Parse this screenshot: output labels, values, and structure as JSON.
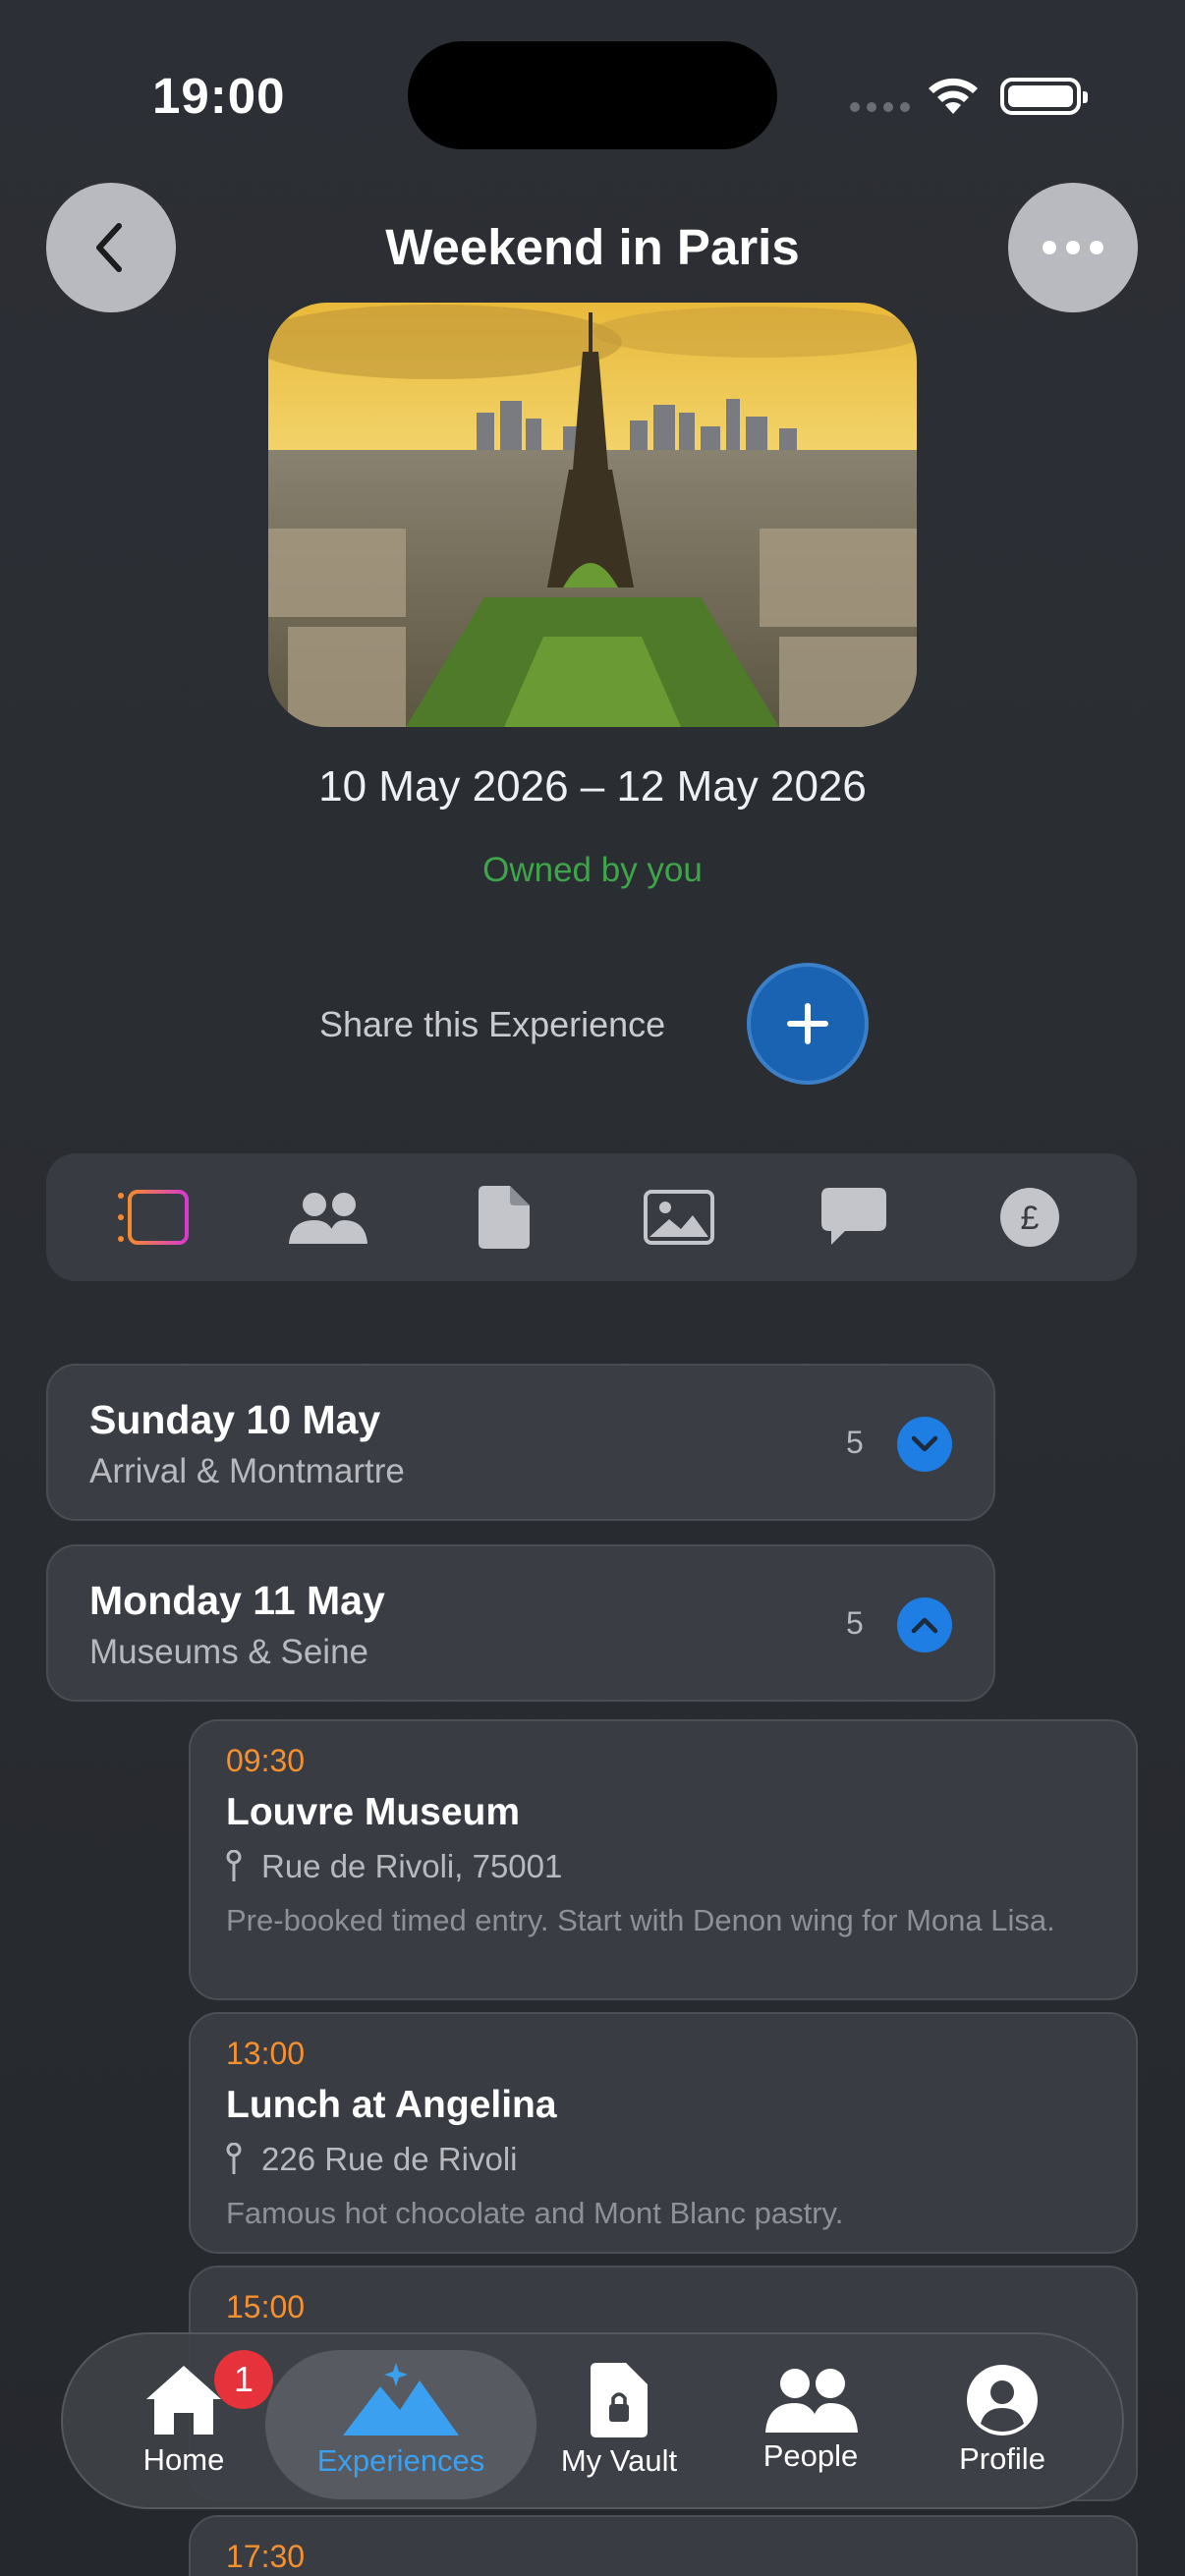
{
  "status": {
    "time": "19:00"
  },
  "header": {
    "title": "Weekend in Paris"
  },
  "trip": {
    "dates": "10 May 2026 – 12 May 2026",
    "owner": "Owned by you",
    "share_label": "Share this Experience"
  },
  "tabs": [
    "itinerary-icon",
    "people-icon",
    "document-icon",
    "photo-icon",
    "chat-icon",
    "pound-icon"
  ],
  "days": [
    {
      "title": "Sunday 10 May",
      "subtitle": "Arrival & Montmartre",
      "count": "5",
      "expanded": false
    },
    {
      "title": "Monday 11 May",
      "subtitle": "Museums & Seine",
      "count": "5",
      "expanded": true
    }
  ],
  "events": [
    {
      "time": "09:30",
      "title": "Louvre Museum",
      "location": "Rue de Rivoli, 75001",
      "note": "Pre-booked timed entry. Start with Denon wing for Mona Lisa."
    },
    {
      "time": "13:00",
      "title": "Lunch at Angelina",
      "location": "226 Rue de Rivoli",
      "note": "Famous hot chocolate and Mont Blanc pastry."
    },
    {
      "time": "15:00"
    },
    {
      "time": "17:30"
    }
  ],
  "nav": {
    "home": "Home",
    "experiences": "Experiences",
    "vault": "My Vault",
    "people": "People",
    "profile": "Profile",
    "home_badge": "1"
  },
  "colors": {
    "accent_blue": "#1e7ee4",
    "time_orange": "#f5902f",
    "owned_green": "#3fa54a",
    "active_nav": "#3aa0ef"
  }
}
